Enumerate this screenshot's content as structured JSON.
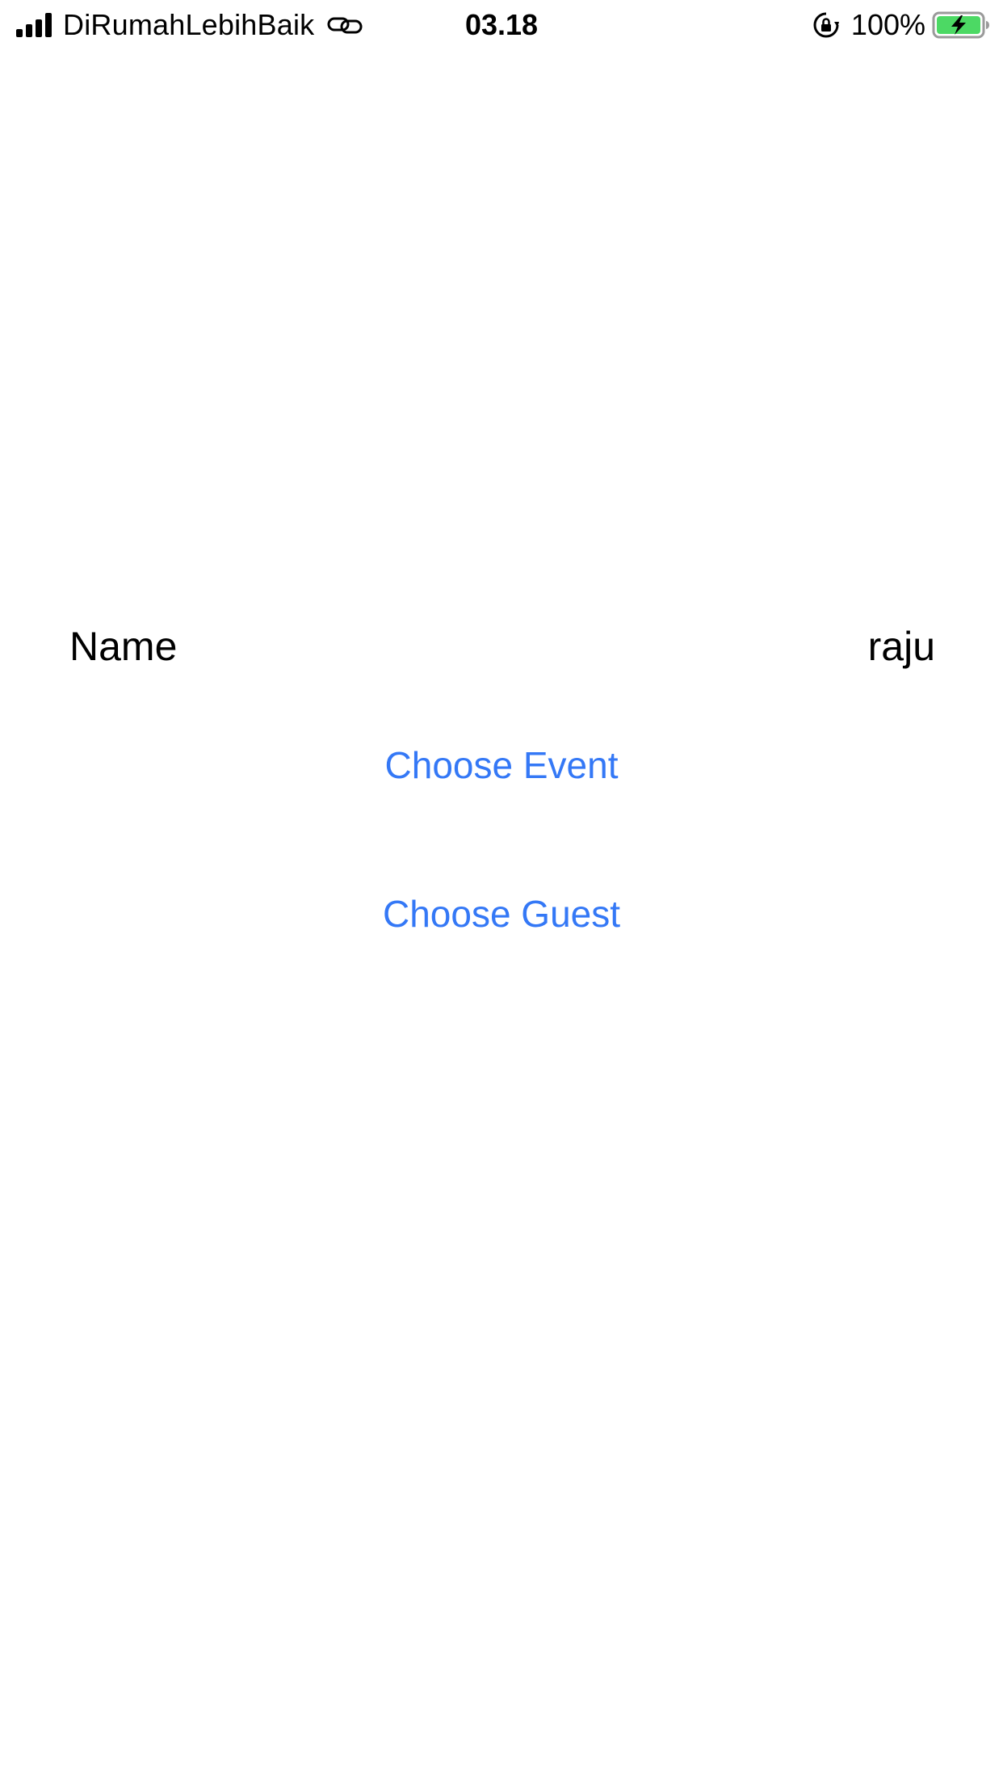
{
  "status_bar": {
    "carrier": "DiRumahLebihBaik",
    "time": "03.18",
    "battery_percent": "100%",
    "battery_level": 1.0,
    "battery_state": "charging",
    "icons": [
      "signal-icon",
      "link-icon",
      "orientation-lock-icon",
      "battery-charging-icon"
    ]
  },
  "form": {
    "name_label": "Name",
    "name_value": "raju"
  },
  "actions": {
    "choose_event_label": "Choose Event",
    "choose_guest_label": "Choose Guest"
  },
  "colors": {
    "accent": "#3478F6",
    "text": "#000000",
    "background": "#FFFFFF",
    "battery_fill": "#4CD964"
  }
}
